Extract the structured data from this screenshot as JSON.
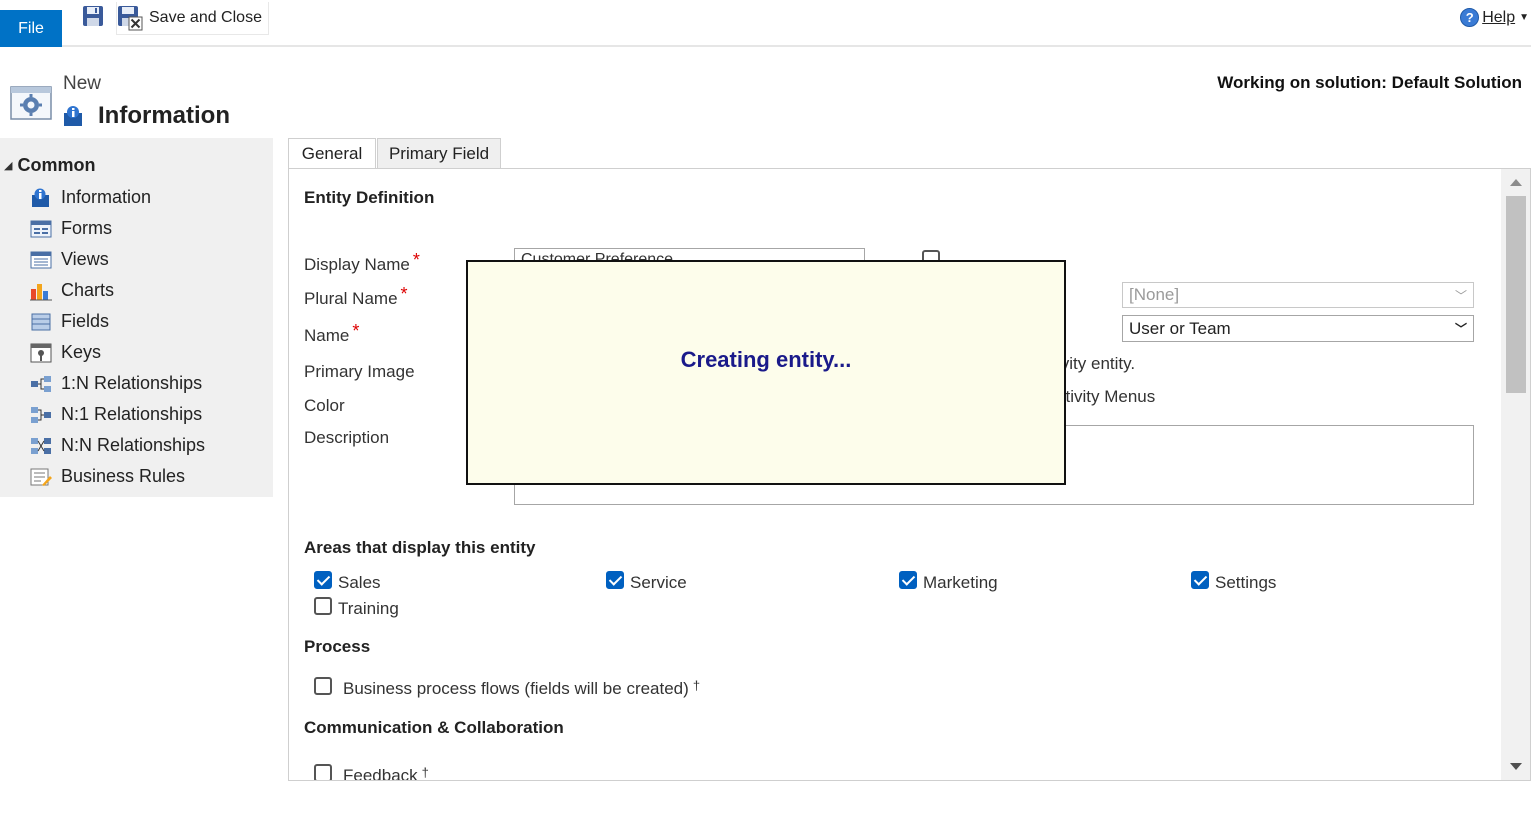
{
  "ribbon": {
    "file_label": "File",
    "save_close_label": "Save and Close",
    "help_label": "Help"
  },
  "header": {
    "new_label": "New",
    "title": "Information",
    "solution_text": "Working on solution: Default Solution"
  },
  "sidebar": {
    "section_label": "Common",
    "items": [
      {
        "label": "Information",
        "icon": "info-icon"
      },
      {
        "label": "Forms",
        "icon": "forms-icon"
      },
      {
        "label": "Views",
        "icon": "views-icon"
      },
      {
        "label": "Charts",
        "icon": "charts-icon"
      },
      {
        "label": "Fields",
        "icon": "fields-icon"
      },
      {
        "label": "Keys",
        "icon": "keys-icon"
      },
      {
        "label": "1:N Relationships",
        "icon": "relationship-icon"
      },
      {
        "label": "N:1 Relationships",
        "icon": "relationship-icon"
      },
      {
        "label": "N:N Relationships",
        "icon": "relationship-icon"
      },
      {
        "label": "Business Rules",
        "icon": "business-rules-icon"
      }
    ]
  },
  "tabs": [
    {
      "label": "General",
      "active": true
    },
    {
      "label": "Primary Field",
      "active": false
    }
  ],
  "form": {
    "entity_definition_title": "Entity Definition",
    "display_name_label": "Display Name",
    "plural_name_label": "Plural Name",
    "name_label": "Name",
    "primary_image_label": "Primary Image",
    "color_label": "Color",
    "description_label": "Description",
    "display_name_value": "Customer Preference",
    "primary_image_select": "[None]",
    "ownership_select": "User or Team",
    "activity_entity_fragment": "ivity entity.",
    "activity_menus_fragment": "ctivity Menus",
    "areas_title": "Areas that display this entity",
    "areas": [
      {
        "label": "Sales",
        "checked": true
      },
      {
        "label": "Service",
        "checked": true
      },
      {
        "label": "Marketing",
        "checked": true
      },
      {
        "label": "Settings",
        "checked": true
      },
      {
        "label": "Training",
        "checked": false
      }
    ],
    "process_title": "Process",
    "bpf_label": "Business process flows (fields will be created)",
    "bpf_checked": false,
    "dagger": "†",
    "comm_title": "Communication & Collaboration",
    "feedback_label": "Feedback"
  },
  "modal": {
    "message": "Creating entity..."
  },
  "colors": {
    "file_blue": "#0072c6",
    "modal_bg": "#fdfdeb",
    "modal_text": "#1a1a8a",
    "checkbox_blue": "#0060c0"
  }
}
